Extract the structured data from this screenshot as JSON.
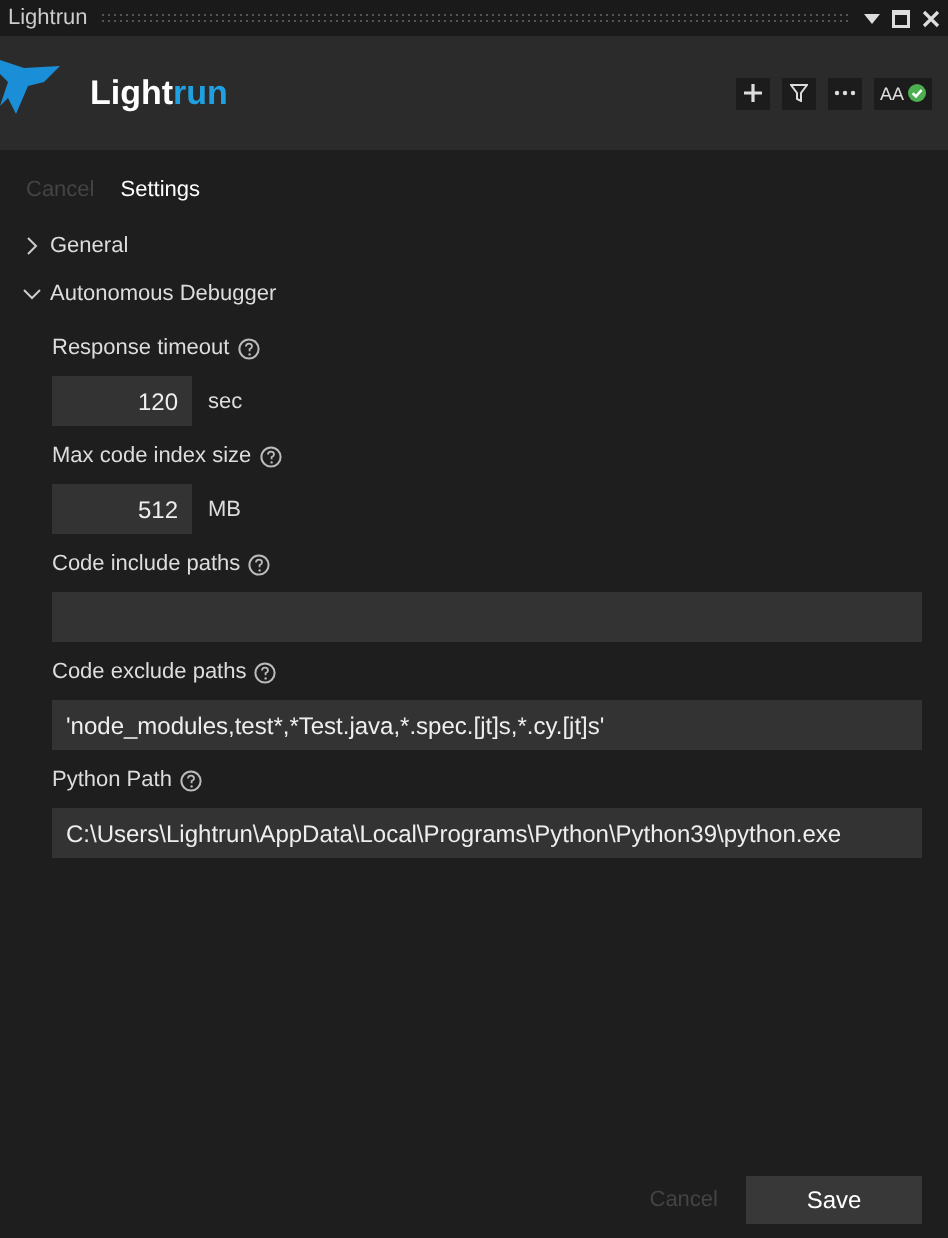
{
  "window": {
    "title": "Lightrun"
  },
  "header": {
    "logo_main": "Light",
    "logo_accent": "run",
    "badge": "AA",
    "connected": true
  },
  "nav": [
    {
      "label": "Cancel",
      "disabled": true
    },
    {
      "label": "Settings",
      "disabled": false
    }
  ],
  "sections": [
    {
      "title": "General",
      "expanded": false
    },
    {
      "title": "Autonomous Debugger",
      "expanded": true,
      "fields": [
        {
          "kind": "number",
          "label": "Response timeout",
          "value": "120",
          "unit": "sec"
        },
        {
          "kind": "number",
          "label": "Max code index size",
          "value": "512",
          "unit": "MB"
        },
        {
          "kind": "text",
          "label": "Code include paths"
        },
        {
          "kind": "text",
          "label": "Code exclude paths",
          "value": "'node_modules,test*,*Test.java,*.spec.[jt]s,*.cy.[jt]s'"
        },
        {
          "kind": "text",
          "label": "Python Path",
          "value": "C:\\Users\\Lightrun\\AppData\\Local\\Programs\\Python\\Python39\\python.exe"
        }
      ]
    }
  ],
  "footer": [
    {
      "label": "Cancel",
      "disabled": true
    },
    {
      "label": "Save",
      "disabled": false
    }
  ]
}
